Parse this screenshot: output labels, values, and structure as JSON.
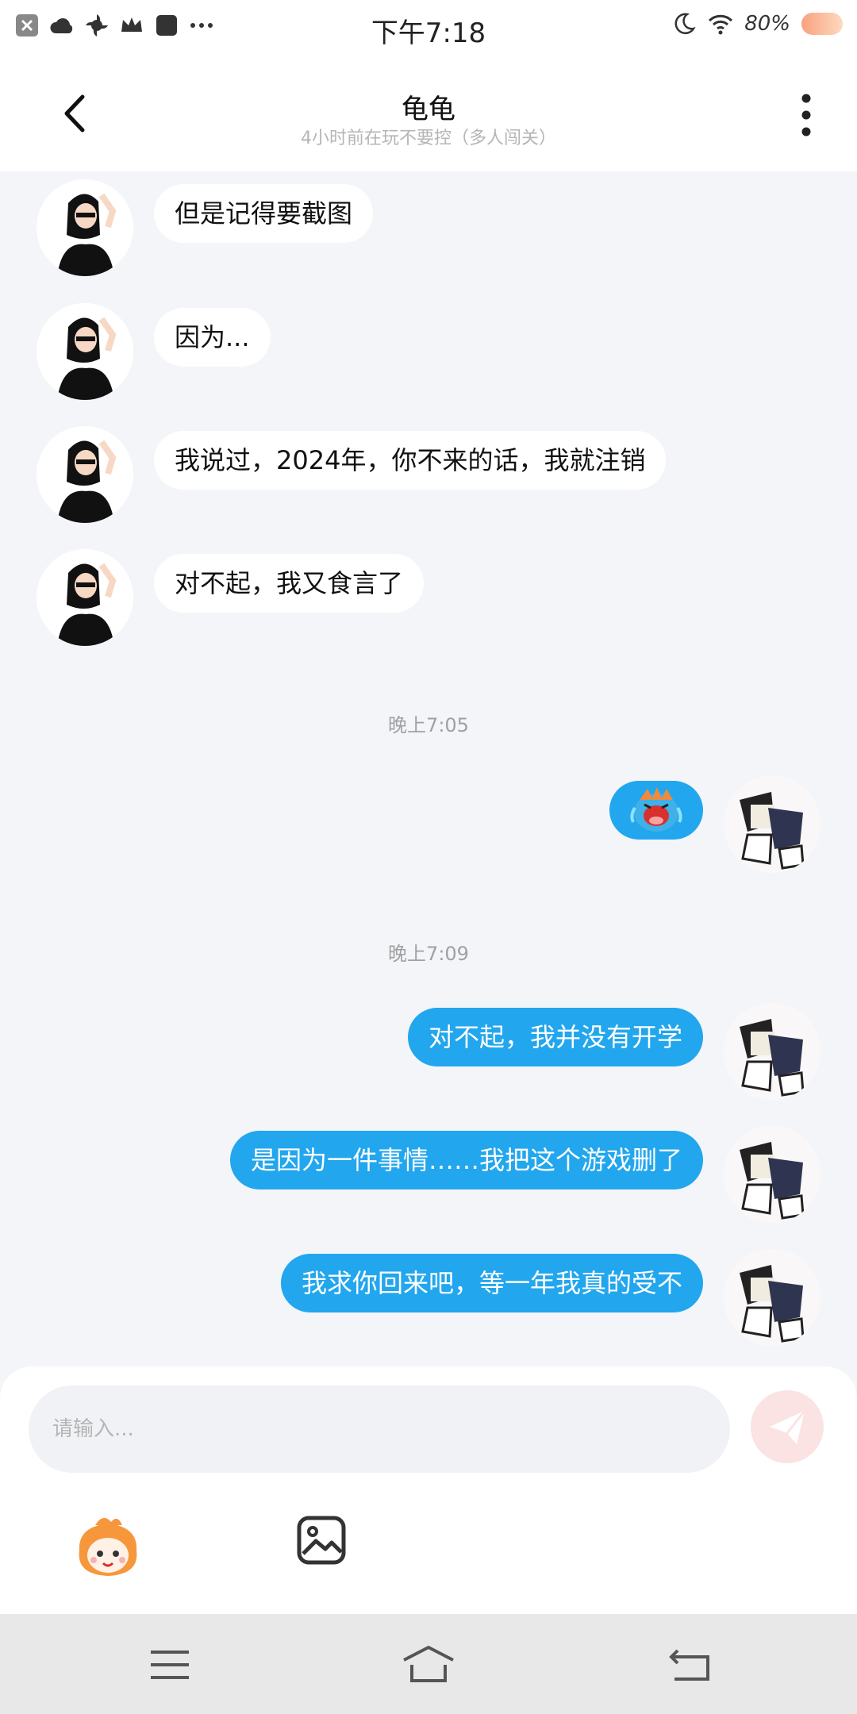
{
  "status_bar": {
    "time": "下午7:18",
    "battery_percent": "80%",
    "left_icons": [
      "close-icon",
      "cloud-icon",
      "pinwheel-icon",
      "crown-icon",
      "square-app-icon",
      "more-dots-icon"
    ],
    "right_icons": [
      "moon-icon",
      "wifi-icon",
      "battery-icon"
    ]
  },
  "header": {
    "title": "龟龟",
    "subtitle": "4小时前在玩不要控（多人闯关）"
  },
  "messages": [
    {
      "side": "in",
      "text": "但是记得要截图"
    },
    {
      "side": "in",
      "text": "因为..."
    },
    {
      "side": "in",
      "text": "我说过，2024年，你不来的话，我就注销"
    },
    {
      "side": "in",
      "text": "对不起，我又食言了"
    },
    {
      "side": "out",
      "type": "sticker",
      "sticker": "crying-dragon-sticker"
    },
    {
      "side": "out",
      "text": "对不起，我并没有开学"
    },
    {
      "side": "out",
      "text": "是因为一件事情……我把这个游戏删了"
    },
    {
      "side": "out",
      "text": "我求你回来吧，等一年我真的受不"
    }
  ],
  "timestamps": [
    "晚上7:05",
    "晚上7:09"
  ],
  "composer": {
    "placeholder": "请输入...",
    "buttons": [
      "send-icon",
      "emoji-icon",
      "image-icon"
    ]
  },
  "colors": {
    "accent": "#22a6ee",
    "background": "#f3f5f9",
    "incoming_bubble": "#ffffff",
    "send_button": "#fbe3e3"
  }
}
